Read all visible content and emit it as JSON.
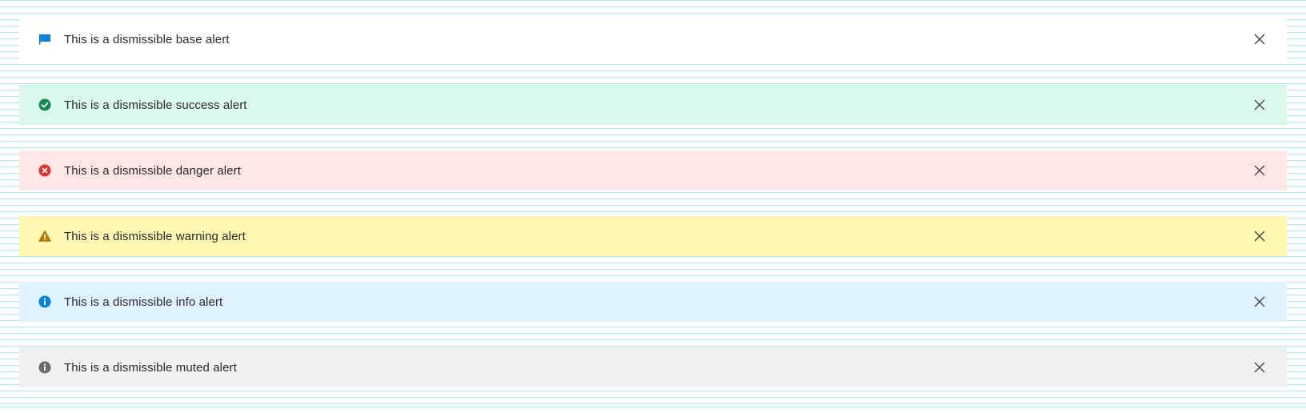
{
  "alerts": [
    {
      "variant": "base",
      "icon": "flag-icon",
      "icon_color": "#0a7fd8",
      "text": "This is a dismissible base alert",
      "background": "#ffffff"
    },
    {
      "variant": "success",
      "icon": "check-circle-icon",
      "icon_color": "#108a4c",
      "text": "This is a dismissible success alert",
      "background": "#d9f7ea"
    },
    {
      "variant": "danger",
      "icon": "x-circle-icon",
      "icon_color": "#e0322f",
      "text": "This is a dismissible danger alert",
      "background": "#ffe5e5"
    },
    {
      "variant": "warning",
      "icon": "warning-triangle-icon",
      "icon_color": "#b67a00",
      "text": "This is a dismissible warning alert",
      "background": "#fff8b2"
    },
    {
      "variant": "info",
      "icon": "info-circle-icon",
      "icon_color": "#0a7fd8",
      "text": "This is a dismissible info alert",
      "background": "#dff0ff"
    },
    {
      "variant": "muted",
      "icon": "info-circle-icon",
      "icon_color": "#6b6b6b",
      "text": "This is a dismissible muted alert",
      "background": "#f0efef"
    }
  ],
  "close_icon": "close-icon",
  "close_icon_color": "#444444"
}
